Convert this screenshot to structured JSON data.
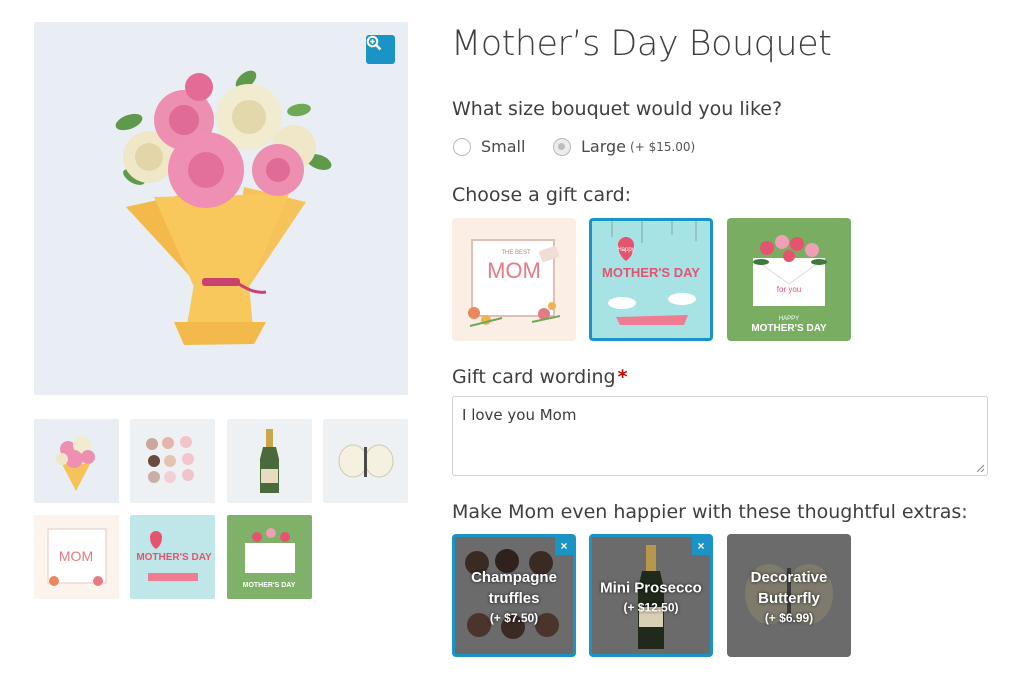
{
  "product": {
    "title": "Mother’s Day Bouquet"
  },
  "size": {
    "label": "What size bouquet would you like?",
    "options": [
      {
        "label": "Small",
        "price": "",
        "selected": false
      },
      {
        "label": "Large",
        "price": "(+ $15.00)",
        "selected": true
      }
    ]
  },
  "gift_card": {
    "label": "Choose a gift card:",
    "cards": [
      {
        "name": "best-mom-card",
        "text_1": "MOM",
        "text_2": "THE BEST",
        "selected": false
      },
      {
        "name": "happy-mothers-day-card",
        "text_1": "Happy",
        "text_2": "MOTHER'S DAY",
        "selected": true
      },
      {
        "name": "for-you-card",
        "text_1": "for you",
        "text_2": "MOTHER'S DAY",
        "text_3": "HAPPY",
        "selected": false
      }
    ]
  },
  "wording": {
    "label": "Gift card wording",
    "required_mark": "*",
    "value": "I love you Mom"
  },
  "extras": {
    "label": "Make Mom even happier with these thoughtful extras:",
    "items": [
      {
        "name_1": "Champagne",
        "name_2": "truffles",
        "price": "(+ $7.50)",
        "selected": true
      },
      {
        "name_1": "Mini Prosecco",
        "name_2": "",
        "price": "(+ $12.50)",
        "selected": true
      },
      {
        "name_1": "Decorative",
        "name_2": "Butterfly",
        "price": "(+ $6.99)",
        "selected": false
      }
    ],
    "remove_glyph": "×"
  },
  "colors": {
    "accent": "#1a94c4",
    "required": "#cc0000"
  },
  "icons": {
    "zoom": "magnifier-plus-icon"
  }
}
